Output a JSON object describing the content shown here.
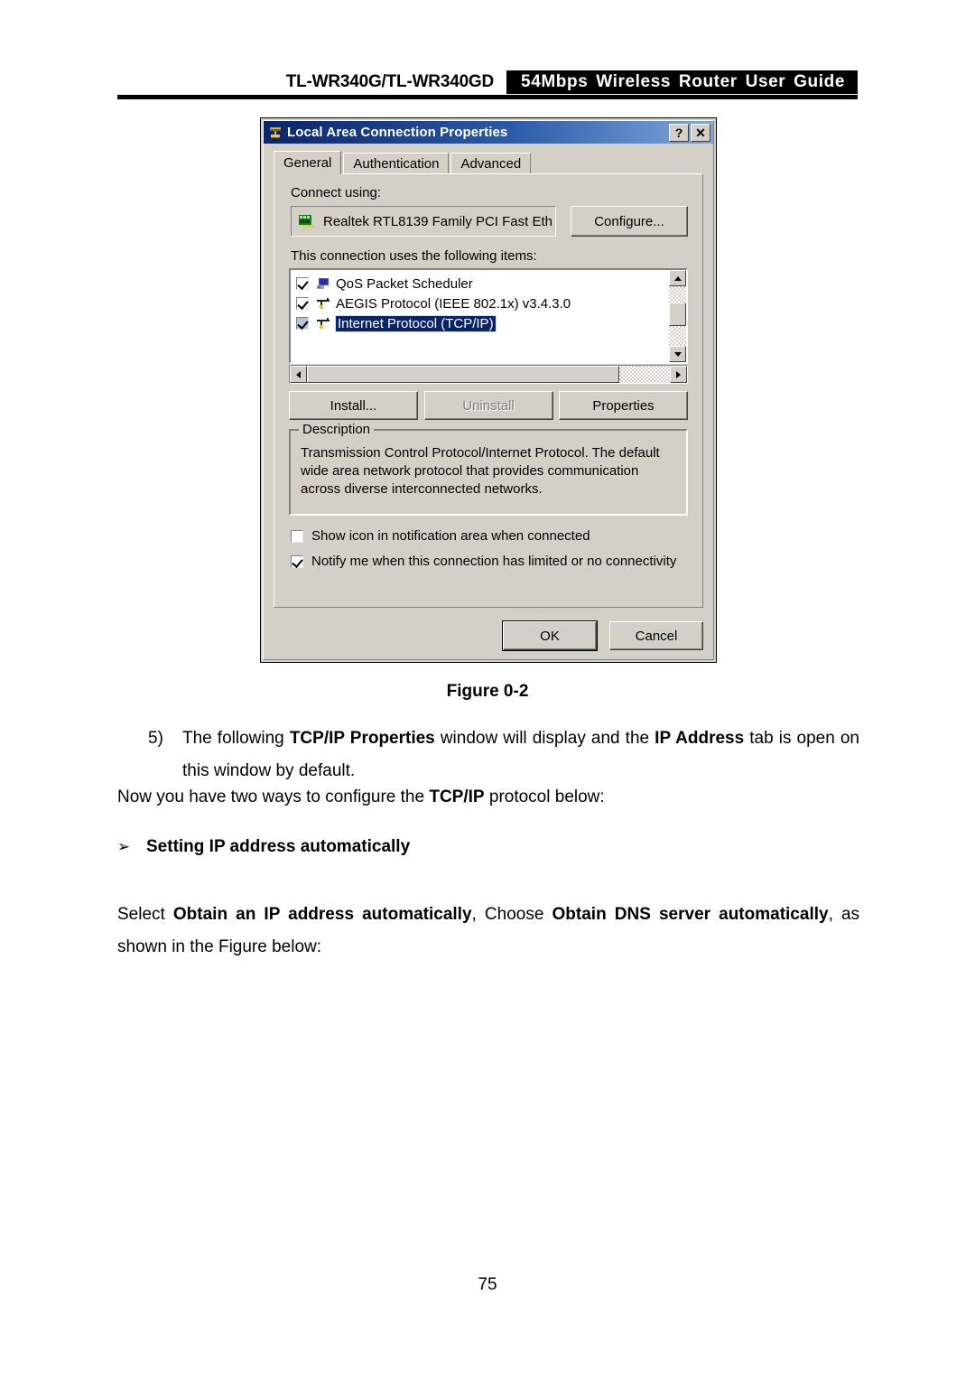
{
  "header": {
    "model": "TL-WR340G/TL-WR340GD",
    "band_title": "54Mbps Wireless Router User Guide"
  },
  "dialog": {
    "title": "Local Area Connection    Properties",
    "title_icon": "network-connection-icon",
    "help_button": "?",
    "close_button": "✕",
    "tabs": [
      {
        "label": "General",
        "active": true
      },
      {
        "label": "Authentication",
        "active": false
      },
      {
        "label": "Advanced",
        "active": false
      }
    ],
    "connect_using_label": "Connect using:",
    "adapter": {
      "icon": "network-adapter-icon",
      "name": "Realtek RTL8139 Family PCI Fast Eth"
    },
    "configure_button": "Configure...",
    "items_label": "This connection uses the following items:",
    "items": [
      {
        "label": "QoS Packet Scheduler",
        "checked": true,
        "selected": false,
        "icon": "qos-scheduler-icon"
      },
      {
        "label": "AEGIS Protocol (IEEE 802.1x) v3.4.3.0",
        "checked": true,
        "selected": false,
        "icon": "protocol-icon"
      },
      {
        "label": "Internet Protocol (TCP/IP)",
        "checked": true,
        "selected": true,
        "icon": "protocol-icon"
      }
    ],
    "action_buttons": [
      {
        "label": "Install...",
        "disabled": false
      },
      {
        "label": "Uninstall",
        "disabled": true
      },
      {
        "label": "Properties",
        "disabled": false
      }
    ],
    "description": {
      "title": "Description",
      "text": "Transmission Control Protocol/Internet Protocol. The default wide area network protocol that provides communication across diverse interconnected networks."
    },
    "checkboxes": [
      {
        "label": "Show icon in notification area when connected",
        "checked": false
      },
      {
        "label": "Notify me when this connection has limited or no connectivity",
        "checked": true
      }
    ],
    "footer_buttons": [
      {
        "label": "OK",
        "default": true
      },
      {
        "label": "Cancel",
        "default": false
      }
    ]
  },
  "content": {
    "figure_caption": "Figure 0-2",
    "step_number": "5)",
    "step_text_1": "The following ",
    "step_bold_1": "TCP/IP Properties",
    "step_text_2": " window will display and the ",
    "step_bold_2": "IP Address",
    "step_text_3": " tab is open on this window by default.",
    "para_1_a": "Now you have two ways to configure the ",
    "para_1_bold": "TCP/IP",
    "para_1_b": " protocol below:",
    "bullet_glyph": "➢",
    "bullet_heading": "Setting IP address automatically",
    "para_2_a": "Select ",
    "para_2_bold_1": "Obtain an IP address automatically",
    "para_2_b": ", Choose ",
    "para_2_bold_2": "Obtain DNS server automatically",
    "para_2_c": ", as shown in the Figure below:",
    "page_number": "75"
  }
}
